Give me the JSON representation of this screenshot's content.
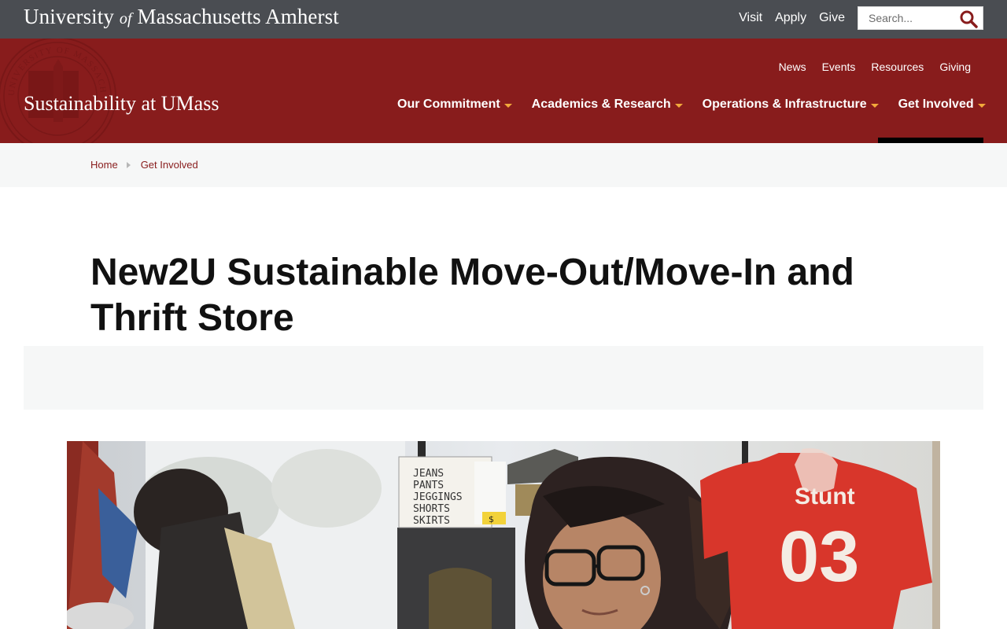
{
  "topbar": {
    "wordmark": {
      "part1": "University",
      "of": "of",
      "part2": "Massachusetts Amherst"
    },
    "links": [
      "Visit",
      "Apply",
      "Give"
    ],
    "search_placeholder": "Search..."
  },
  "header": {
    "site_title": "Sustainability at UMass",
    "utility_nav": [
      "News",
      "Events",
      "Resources",
      "Giving"
    ],
    "main_nav": [
      "Our Commitment",
      "Academics & Research",
      "Operations & Infrastructure",
      "Get Involved"
    ],
    "active_nav": "Get Involved",
    "seal_text": "UNIVERSITY OF MASSACHUSETTS AMHERST",
    "caret_color": "#f2a93b",
    "brand_color": "#881c1c"
  },
  "breadcrumb": [
    "Home",
    "Get Involved"
  ],
  "page": {
    "title": "New2U Sustainable Move-Out/Move-In and Thrift Store"
  },
  "photo": {
    "signs": [
      "JEANS",
      "PANTS",
      "JEGGINGS",
      "SHORTS",
      "SKIRTS"
    ],
    "tag_text": "$",
    "jersey_word": "Stunt",
    "jersey_number": "03"
  }
}
